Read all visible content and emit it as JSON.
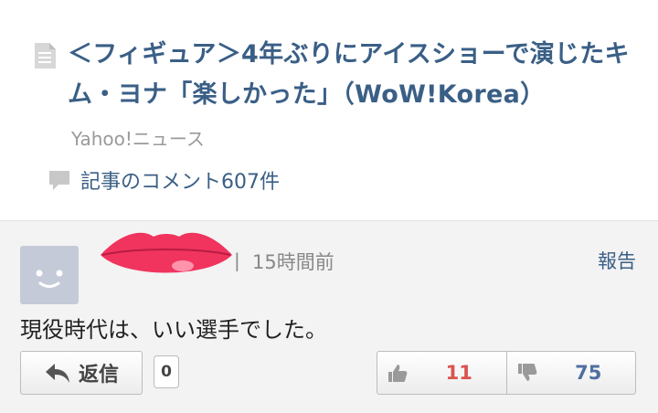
{
  "article": {
    "title": "＜フィギュア＞4年ぶりにアイスショーで演じたキム・ヨナ「楽しかった」（WoW!Korea）",
    "source": "Yahoo!ニュース",
    "comments_link": "記事のコメント607件",
    "icon": "document-icon",
    "accent_color": "#3a5f86"
  },
  "comment": {
    "time": "15時間前",
    "separator": "|",
    "report_label": "報告",
    "body": "現役時代は、いい選手でした。",
    "reply_label": "返信",
    "reply_count": "0",
    "likes": "11",
    "dislikes": "75",
    "like_color": "#d9534f",
    "dislike_color": "#4f6fa0"
  }
}
